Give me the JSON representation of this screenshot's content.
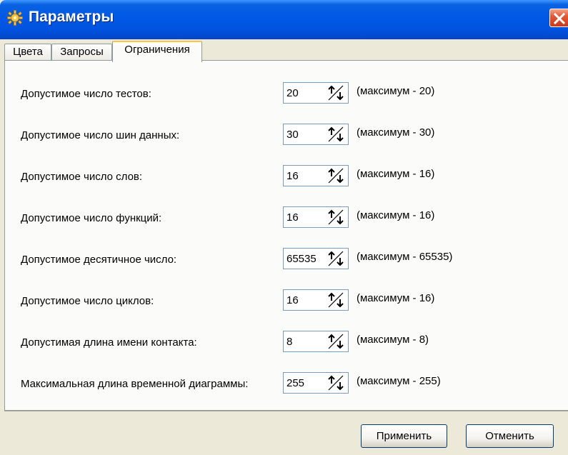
{
  "window": {
    "title": "Параметры",
    "icon": "gear-icon"
  },
  "tabs": [
    {
      "label": "Цвета",
      "active": false
    },
    {
      "label": "Запросы",
      "active": false
    },
    {
      "label": "Ограничения",
      "active": true
    }
  ],
  "limits": [
    {
      "label": "Допустимое число тестов:",
      "value": "20",
      "max": "(максимум - 20)"
    },
    {
      "label": "Допустимое число шин данных:",
      "value": "30",
      "max": "(максимум - 30)"
    },
    {
      "label": "Допустимое число слов:",
      "value": "16",
      "max": "(максимум - 16)"
    },
    {
      "label": "Допустимое число функций:",
      "value": "16",
      "max": "(максимум - 16)"
    },
    {
      "label": "Допустимое десятичное число:",
      "value": "65535",
      "max": "(максимум - 65535)"
    },
    {
      "label": "Допустимое число циклов:",
      "value": "16",
      "max": "(максимум - 16)"
    },
    {
      "label": "Допустимая длина имени контакта:",
      "value": "8",
      "max": "(максимум - 8)"
    },
    {
      "label": "Максимальная длина временной диаграммы:",
      "value": "255",
      "max": "(максимум - 255)"
    }
  ],
  "buttons": {
    "apply": "Применить",
    "cancel": "Отменить"
  },
  "colors": {
    "titlebar": "#0058e6",
    "close": "#e05b38",
    "active_tab_accent": "#ffc83c"
  }
}
